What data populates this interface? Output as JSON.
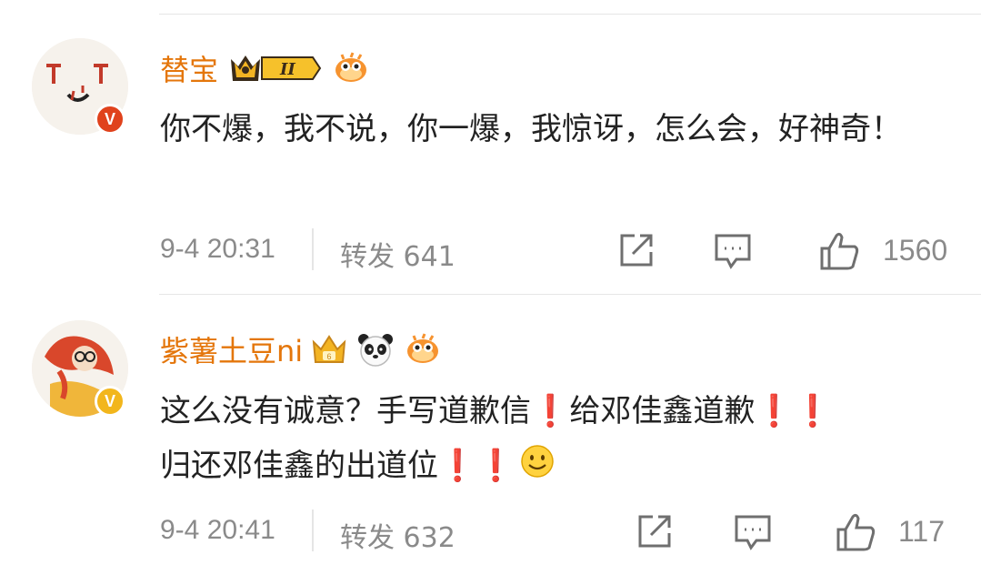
{
  "comments": [
    {
      "username": "替宝",
      "vip_level": "II",
      "text": "你不爆，我不说，你一爆，我惊讶，怎么会，好神奇！",
      "time": "9-4 20:31",
      "repost": "转发 641",
      "likes": "1560",
      "verify_badge": "V",
      "badge_color": "#e0421c"
    },
    {
      "username": "紫薯土豆ni",
      "text_part1": "这么没有诚意？手写道歉信",
      "text_part2": "给邓佳鑫道歉",
      "text_part3": "归还邓佳鑫的出道位",
      "time": "9-4 20:41",
      "repost": "转发 632",
      "likes": "117",
      "verify_badge": "V",
      "badge_color": "#f2b61c"
    }
  ],
  "colors": {
    "username": "#e4760b",
    "meta": "#8a8a8a",
    "exclaim": "#d8232a"
  }
}
